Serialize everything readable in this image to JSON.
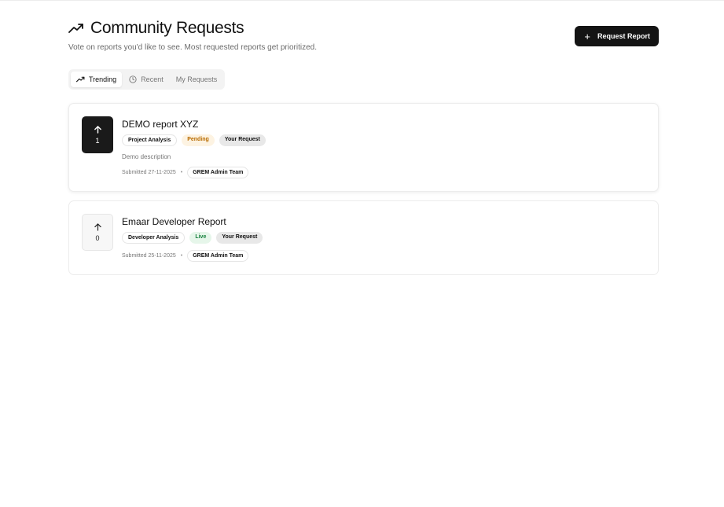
{
  "header": {
    "title": "Community Requests",
    "subtitle": "Vote on reports you'd like to see. Most requested reports get prioritized.",
    "cta_label": "Request Report",
    "cta_icon": "plus-icon"
  },
  "tabs": [
    {
      "label": "Trending",
      "icon": "trending-up-icon",
      "active": true
    },
    {
      "label": "Recent",
      "icon": "clock-icon",
      "active": false
    },
    {
      "label": "My Requests",
      "active": false
    }
  ],
  "requests": [
    {
      "title": "DEMO report XYZ",
      "votes": "1",
      "voted": true,
      "category": "Project Analysis",
      "status": "Pending",
      "owner_tag": "Your Request",
      "description": "Demo description",
      "submitted": "Submitted 27-11-2025",
      "team": "GREM Admin Team"
    },
    {
      "title": "Emaar Developer Report",
      "votes": "0",
      "voted": false,
      "category": "Developer Analysis",
      "status": "Live",
      "owner_tag": "Your Request",
      "submitted": "Submitted 25-11-2025",
      "team": "GREM Admin Team"
    }
  ],
  "colors": {
    "primary": "#141414",
    "pending_text": "#b86b00",
    "pending_bg": "#fdf3e2",
    "live_text": "#17803d",
    "live_bg": "#e6f6ea"
  }
}
